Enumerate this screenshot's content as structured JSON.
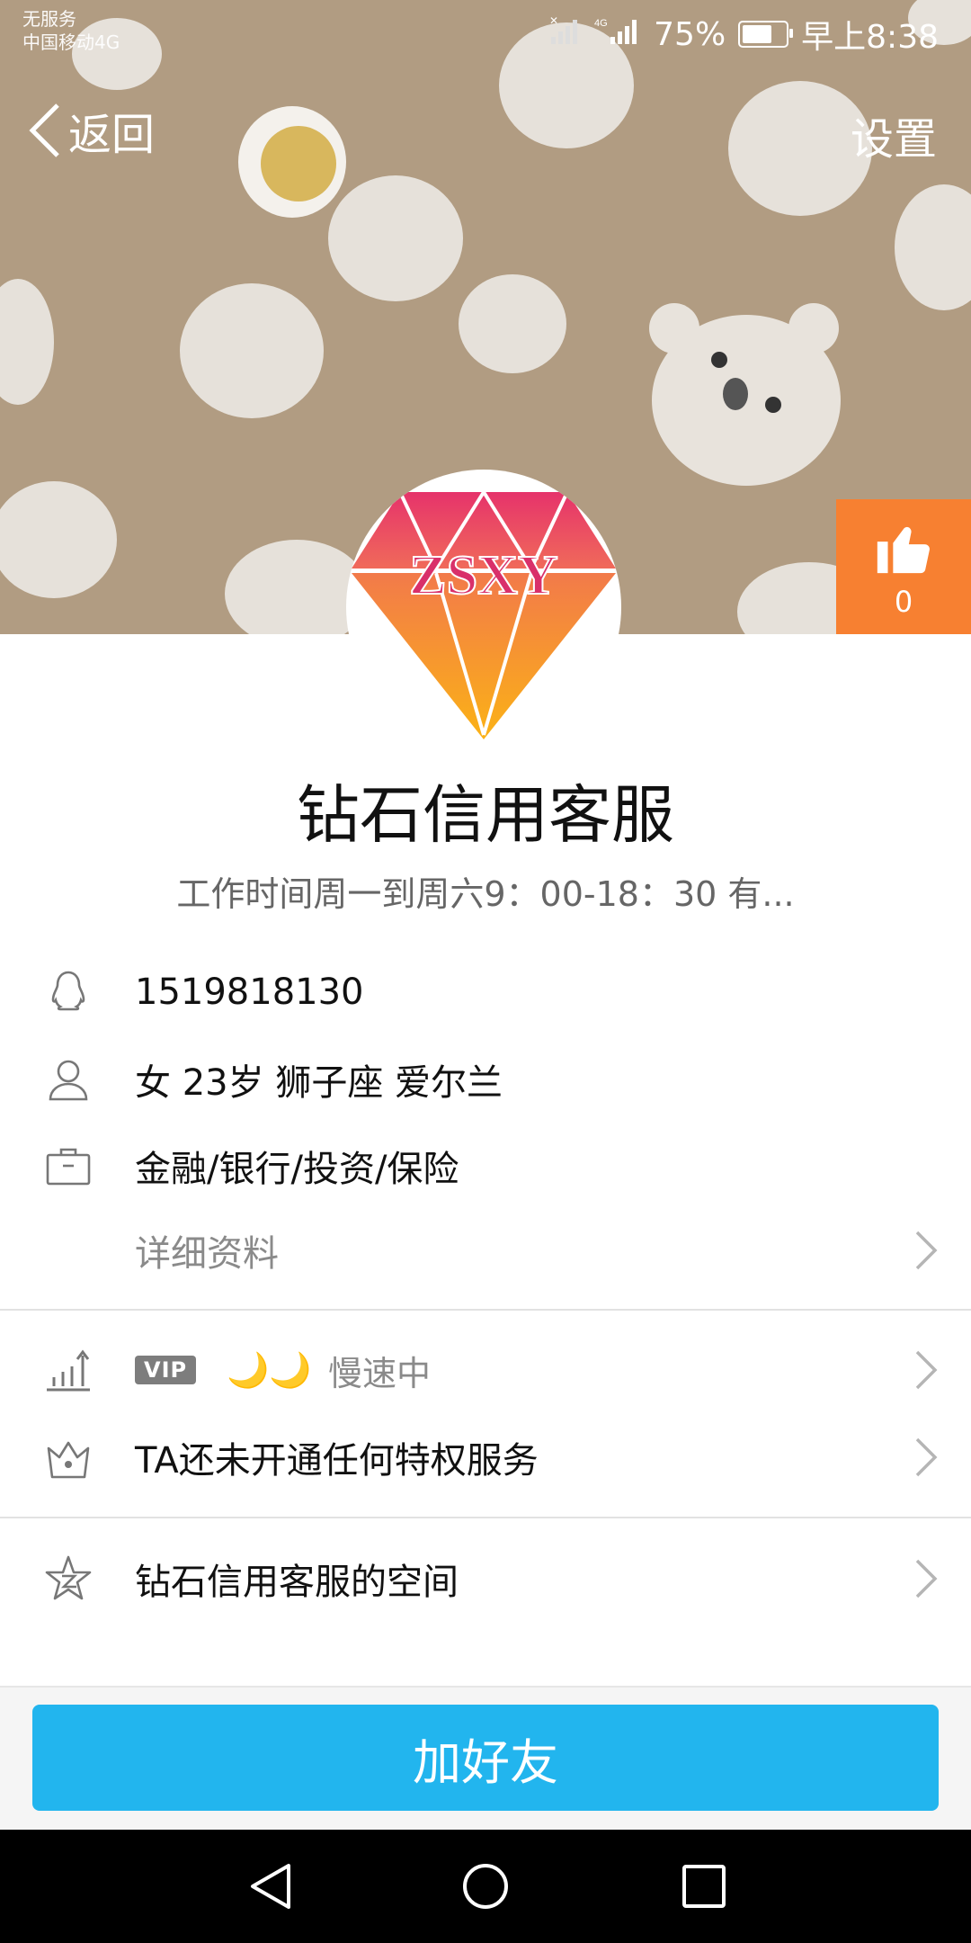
{
  "status_bar": {
    "carrier_line1": "无服务",
    "carrier_line2": "中国移动4G",
    "network": "4G",
    "battery": "75%",
    "battery_level": 0.75,
    "time": "早上8:38"
  },
  "nav": {
    "back_label": "返回",
    "settings_label": "设置"
  },
  "like": {
    "count": "0"
  },
  "avatar": {
    "logo_text": "ZSXY"
  },
  "profile": {
    "name": "钻石信用客服",
    "signature": "工作时间周一到周六9：00-18：30  有..."
  },
  "info": {
    "qq_number": "1519818130",
    "personal": "女  23岁  狮子座  爱尔兰",
    "industry": "金融/银行/投资/保险",
    "detail_link": "详细资料"
  },
  "privilege": {
    "vip_badge": "VIP",
    "moons": "🌙🌙",
    "speed": "慢速中",
    "service": "TA还未开通任何特权服务"
  },
  "space": {
    "label": "钻石信用客服的空间"
  },
  "action": {
    "add_friend": "加好友"
  },
  "colors": {
    "cover_bg": "#b19c82",
    "like_orange": "#f78031",
    "button_blue": "#22b5ee"
  }
}
